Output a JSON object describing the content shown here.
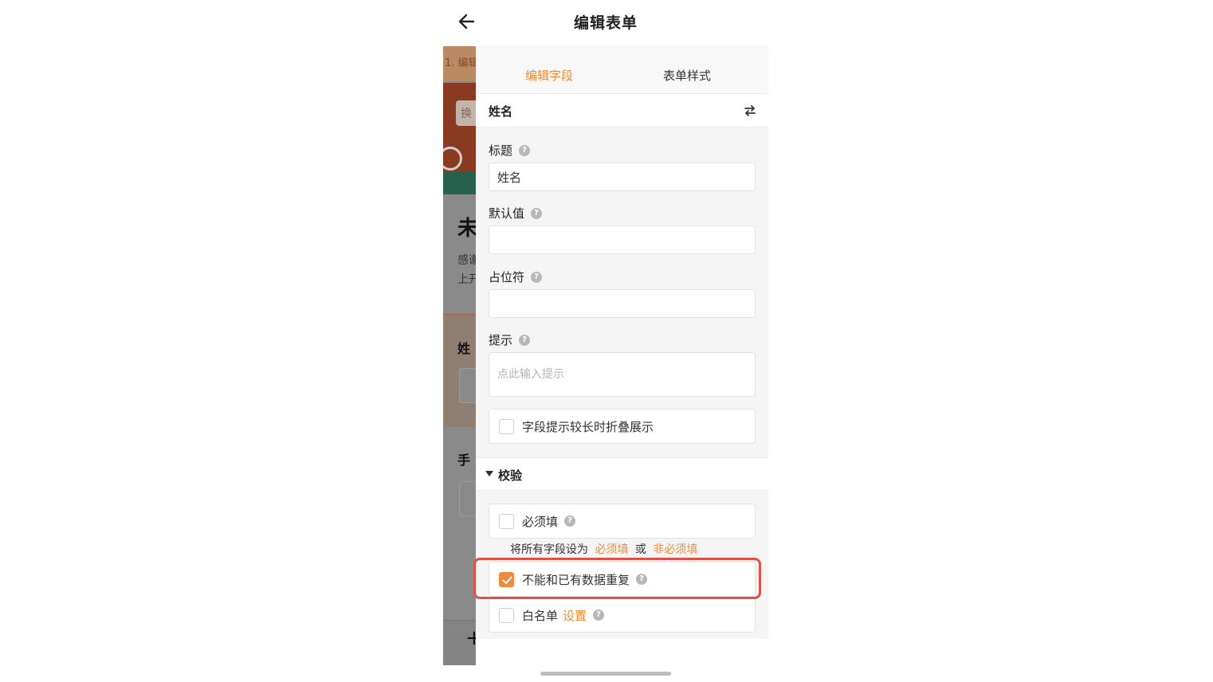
{
  "header": {
    "title": "编辑表单"
  },
  "background_page": {
    "step_label": "1. 编辑",
    "swap_button": "换",
    "heading": "未",
    "desc_line1": "感谢",
    "desc_line2": "上开",
    "field1_label": "姓",
    "field2_label": "手",
    "add_symbol": "+"
  },
  "tabs": [
    {
      "label": "编辑字段",
      "active": true
    },
    {
      "label": "表单样式",
      "active": false
    }
  ],
  "field": {
    "name": "姓名",
    "title_label": "标题",
    "title_value": "姓名",
    "default_label": "默认值",
    "default_value": "",
    "placeholder_label": "占位符",
    "placeholder_value": "",
    "hint_label": "提示",
    "hint_placeholder": "点此输入提示",
    "fold_hint_label": "字段提示较长时折叠展示",
    "fold_hint_checked": false
  },
  "validation": {
    "section_title": "校验",
    "required_label": "必须填",
    "required_checked": false,
    "note_prefix": "将所有字段设为",
    "note_required": "必须填",
    "note_or": "或",
    "note_optional": "非必须填",
    "no_duplicate_label": "不能和已有数据重复",
    "no_duplicate_checked": true,
    "whitelist_label": "白名单",
    "whitelist_link": "设置",
    "whitelist_checked": false
  },
  "help_glyph": "?",
  "colors": {
    "accent": "#f08a3a",
    "highlight": "#e0514a"
  }
}
